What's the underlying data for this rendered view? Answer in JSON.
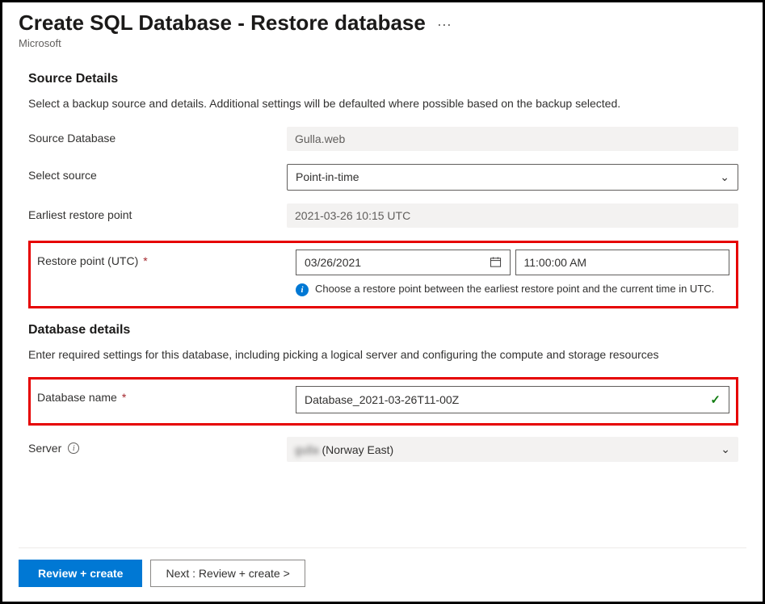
{
  "header": {
    "title": "Create SQL Database - Restore database",
    "ellipsis": "···",
    "subtitle": "Microsoft"
  },
  "sourceDetails": {
    "title": "Source Details",
    "desc": "Select a backup source and details. Additional settings will be defaulted where possible based on the backup selected.",
    "sourceDbLabel": "Source Database",
    "sourceDbValue": "Gulla.web",
    "selectSourceLabel": "Select source",
    "selectSourceValue": "Point-in-time",
    "earliestLabel": "Earliest restore point",
    "earliestValue": "2021-03-26 10:15 UTC",
    "restorePointLabel": "Restore point (UTC)",
    "restoreDate": "03/26/2021",
    "restoreTime": "11:00:00 AM",
    "restoreHint": "Choose a restore point between the earliest restore point and the current time in UTC."
  },
  "databaseDetails": {
    "title": "Database details",
    "desc": "Enter required settings for this database, including picking a logical server and configuring the compute and storage resources",
    "dbNameLabel": "Database name",
    "dbNameValue": "Database_2021-03-26T11-00Z",
    "serverLabel": "Server",
    "serverHidden": "gulla",
    "serverRegion": " (Norway East)"
  },
  "footer": {
    "primary": "Review + create",
    "secondary": "Next : Review + create >"
  }
}
